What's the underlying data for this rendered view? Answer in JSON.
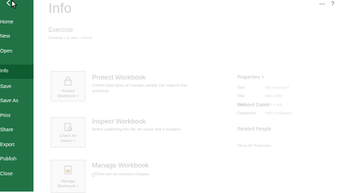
{
  "sidebar": {
    "items": [
      {
        "label": "Home"
      },
      {
        "label": "New"
      },
      {
        "label": "Open"
      },
      {
        "label": "Info"
      },
      {
        "label": "Save"
      },
      {
        "label": "Save As"
      },
      {
        "label": "Print"
      },
      {
        "label": "Share"
      },
      {
        "label": "Export"
      },
      {
        "label": "Publish"
      },
      {
        "label": "Close"
      }
    ]
  },
  "window": {
    "help": "?",
    "minimize": "—"
  },
  "main": {
    "title": "Info",
    "doc_name": "Exercise",
    "doc_path": "Desktop » E-alex » Excel",
    "sections": [
      {
        "tile_label_1": "Protect",
        "tile_label_2": "Workbook ˅",
        "title": "Protect Workbook",
        "desc_1": "Control what types of changes people can make to this",
        "desc_2": "workbook."
      },
      {
        "tile_label_1": "Check for",
        "tile_label_2": "Issues ˅",
        "title": "Inspect Workbook",
        "desc_1": "Before publishing this file, be aware that it contains:",
        "desc_2": ""
      },
      {
        "tile_label_1": "Manage",
        "tile_label_2": "Workbook ˅",
        "title": "Manage Workbook",
        "desc_1": "There are no unsaved changes.",
        "desc_2": ""
      }
    ]
  },
  "properties": {
    "heading": "Properties ˅",
    "rows": [
      {
        "key": "Size",
        "value": "Not saved yet"
      },
      {
        "key": "Title",
        "value": "Add a title"
      },
      {
        "key": "Tags",
        "value": "Add a tag"
      },
      {
        "key": "Categories",
        "value": "Add a category"
      }
    ],
    "related_dates": "Related Dates",
    "related_people": "Related People",
    "show_all": "Show All Properties"
  }
}
